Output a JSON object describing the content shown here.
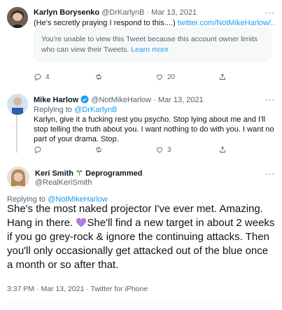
{
  "tweet1": {
    "name": "Karlyn Borysenko",
    "handle": "@DrKarlynB",
    "date": "Mar 13, 2021",
    "text_before": "(He's secretly praying I respond to this....) ",
    "link_text": "twitter.com/NotMikeHarlow/...",
    "notice": "You're unable to view this Tweet because this account owner limits who can view their Tweets. ",
    "notice_link": "Learn more",
    "replies": "4",
    "retweets": "",
    "likes": "20"
  },
  "tweet2": {
    "name": "Mike Harlow",
    "handle": "@NotMikeHarlow",
    "date": "Mar 13, 2021",
    "replying_prefix": "Replying to ",
    "replying_to": "@DrKarlynB",
    "text": "Karlyn, give it a fucking rest you psycho. Stop lying about me and I'll stop telling the truth about you. I want nothing to do with you. I want no part of your drama. Stop.",
    "replies": "",
    "retweets": "",
    "likes": "3"
  },
  "tweet3": {
    "name": "Keri Smith",
    "name_suffix": "Deprogrammed",
    "handle": "@RealKeriSmith",
    "replying_prefix": "Replying to ",
    "replying_to": "@NotMikeHarlow",
    "text_part1": "She's the most naked projector I've ever met. Amazing. Hang in there. ",
    "text_part2": "She'll find a new target in about 2 weeks if you go grey-rock & ignore the continuing attacks. Then you'll only occasionally get attacked out of the blue once a month or so after that.",
    "time": "3:37 PM",
    "date": "Mar 13, 2021",
    "source": "Twitter for iPhone"
  },
  "separator": " · ",
  "more": "···",
  "colors": {
    "link": "#1d9bf0",
    "verified": "#1d9bf0",
    "heart": "#b07fe0",
    "muted": "#536471"
  }
}
